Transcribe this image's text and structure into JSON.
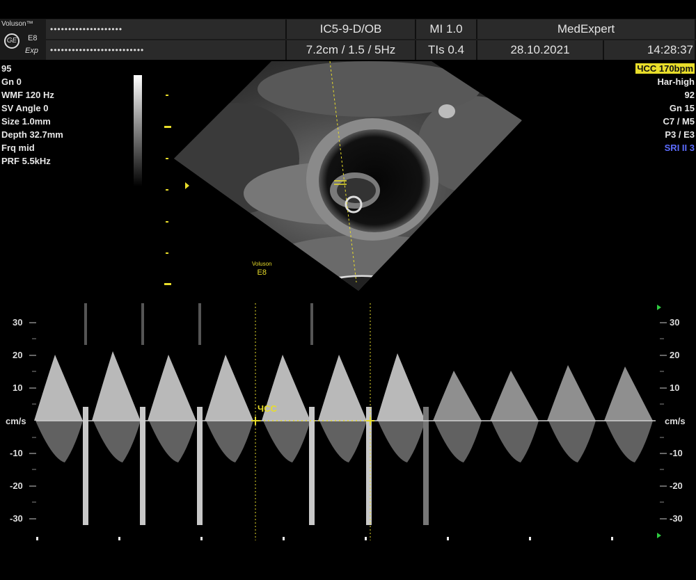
{
  "header": {
    "brand": "Voluson™",
    "model_top": "E8",
    "model_sub": "Exp",
    "patient_name_masked": "••••••••••••••••••••",
    "patient_id_masked": "••••••••••••••••••••••••••",
    "probe": "IC5-9-D/OB",
    "mi": "MI  1.0",
    "institution": "MedExpert",
    "imaging": "7.2cm / 1.5 /  5Hz",
    "tis": "TIs  0.4",
    "date": "28.10.2021",
    "time": "14:28:37"
  },
  "left_params": [
    "95",
    "Gn  0",
    "WMF 120 Hz",
    "SV Angle  0",
    "Size  1.0mm",
    "Depth 32.7mm",
    "Frq mid",
    "PRF  5.5kHz"
  ],
  "right_params": {
    "heart_rate": "ЧСС 170bpm",
    "lines": [
      "Har-high",
      "92",
      "Gn  15",
      "C7 / M5",
      "P3 / E3"
    ],
    "sri": "SRI II 3"
  },
  "watermark": {
    "line1": "Voluson",
    "line2": "E8"
  },
  "doppler": {
    "unit": "cm/s",
    "ticks": [
      "30",
      "20",
      "10",
      "-10",
      "-20",
      "-30"
    ],
    "caliper_label": "ЧСС"
  },
  "colors": {
    "accent_yellow": "#e8dd2a",
    "sri_blue": "#5c6cff",
    "cursor_green": "#2ecc40"
  }
}
